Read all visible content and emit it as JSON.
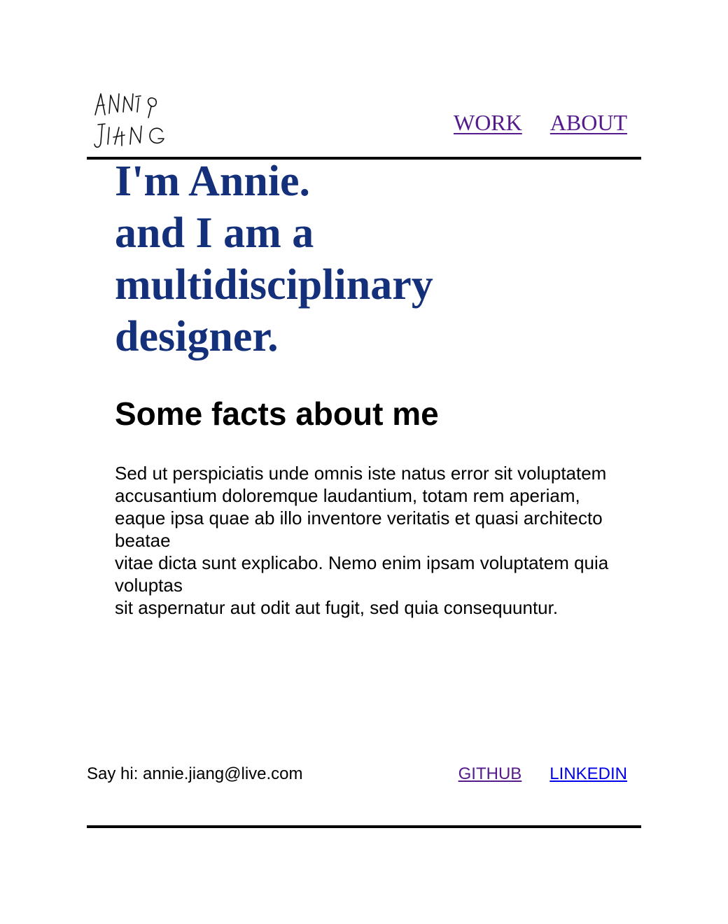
{
  "logo": {
    "line1": "ANNIE",
    "line2": "JIANG"
  },
  "nav": {
    "items": [
      {
        "label": "WORK"
      },
      {
        "label": "ABOUT"
      }
    ]
  },
  "hero": {
    "lines": [
      "I'm Annie.",
      "and I am a",
      "multidisciplinary",
      "designer."
    ]
  },
  "facts": {
    "title": "Some facts about me",
    "lines": [
      "Sed ut perspiciatis unde omnis iste natus error sit voluptatem accusantium doloremque laudantium, totam rem aperiam,",
      "eaque ipsa quae ab illo inventore veritatis et quasi architecto beatae",
      "vitae dicta sunt explicabo. Nemo enim ipsam voluptatem quia voluptas",
      "sit aspernatur aut odit aut fugit, sed quia consequuntur."
    ]
  },
  "footer": {
    "contact": "Say hi: annie.jiang@live.com",
    "links": [
      {
        "label": "GITHUB"
      },
      {
        "label": "LINKEDIN"
      }
    ]
  },
  "colors": {
    "hero_text": "#14307a",
    "visited_link": "#551a8b",
    "link": "#0000ee",
    "rule": "#000000"
  }
}
